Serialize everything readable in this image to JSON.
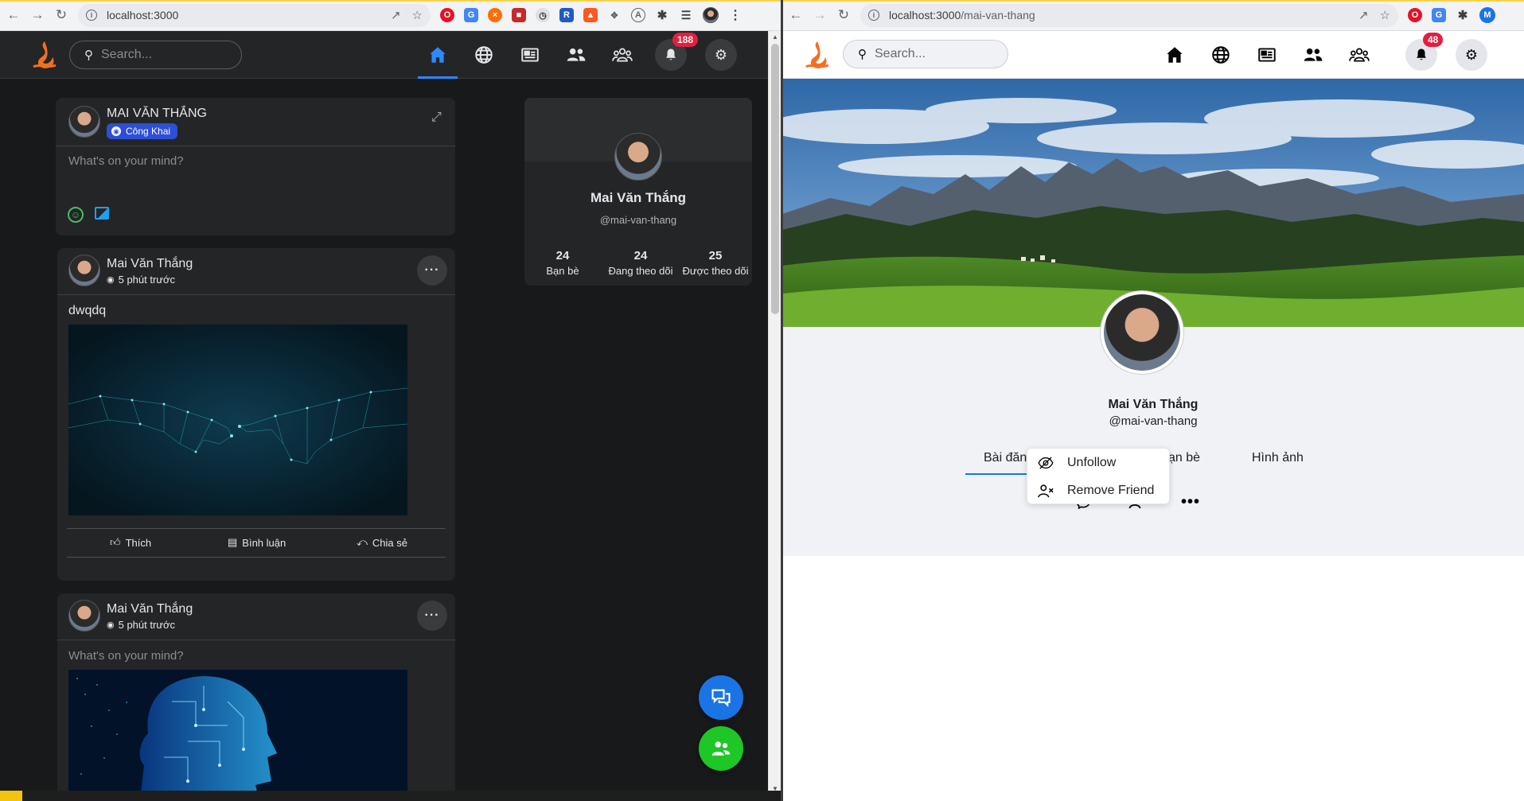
{
  "left_window": {
    "address_url": "localhost:3000",
    "search_placeholder": "Search...",
    "notification_count": "188",
    "composer": {
      "user_name": "MAI VĂN THẮNG",
      "privacy_label": "Công Khai",
      "placeholder": "What's on your mind?"
    },
    "posts": [
      {
        "author": "Mai Văn Thắng",
        "time": "5 phút trước",
        "text": "dwqdq",
        "actions": {
          "like": "Thích",
          "comment": "Bình luận",
          "share": "Chia sẻ"
        }
      },
      {
        "author": "Mai Văn Thắng",
        "time": "5 phút trước",
        "text": "What's on your mind?"
      }
    ],
    "profile_card": {
      "name": "Mai Văn Thắng",
      "handle": "@mai-van-thang",
      "stats": [
        {
          "value": "24",
          "label": "Bạn bè"
        },
        {
          "value": "24",
          "label": "Đang theo dõi"
        },
        {
          "value": "25",
          "label": "Được theo dõi"
        }
      ]
    }
  },
  "right_window": {
    "address_url": "localhost:3000/mai-van-thang",
    "url_host": "localhost:3000",
    "url_path": "/mai-van-thang",
    "search_placeholder": "Search...",
    "notification_count": "48",
    "profile": {
      "name": "Mai Văn Thắng",
      "handle": "@mai-van-thang"
    },
    "tabs": [
      "Bài đăn",
      "ạn bè",
      "Hình ảnh"
    ],
    "dropdown": {
      "items": [
        "Unfollow",
        "Remove Friend"
      ]
    },
    "profile_initial": "M"
  },
  "colors": {
    "accent": "#2d88ff",
    "badge": "#e41e3f",
    "dark_bg": "#18191a",
    "card_bg": "#242526",
    "fab_chat": "#1b74e4",
    "fab_group": "#1ec726"
  }
}
